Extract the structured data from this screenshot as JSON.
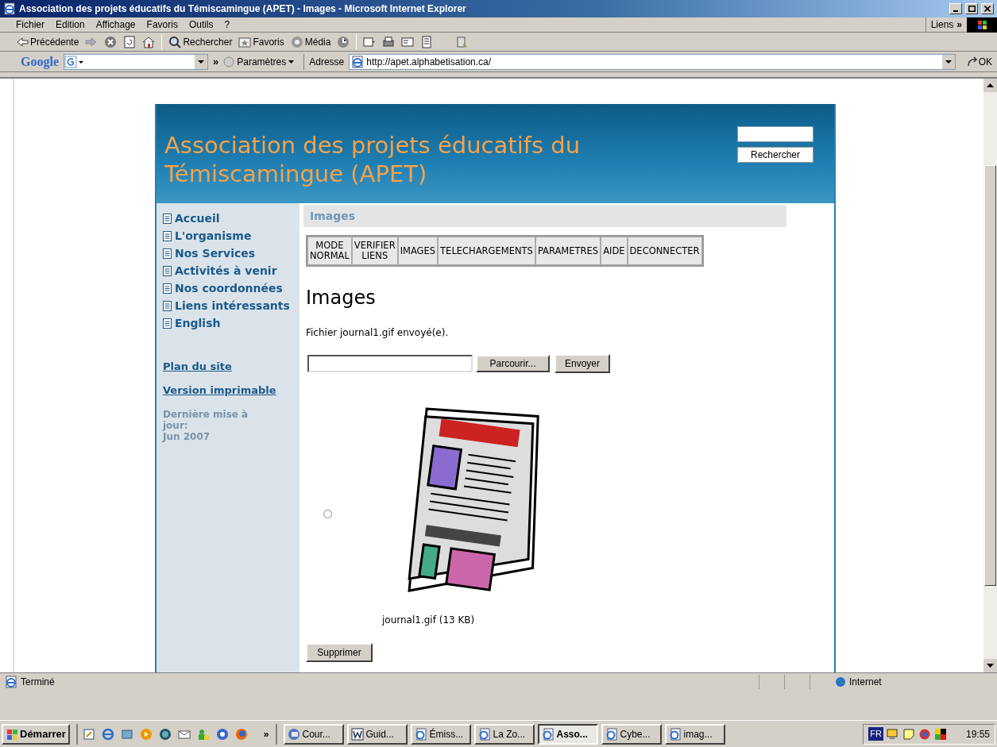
{
  "window": {
    "title": "Association des projets éducatifs du Témiscamingue (APET) - Images - Microsoft Internet Explorer"
  },
  "menu": [
    "Fichier",
    "Edition",
    "Affichage",
    "Favoris",
    "Outils",
    "?"
  ],
  "links_bar": {
    "label": "Liens",
    "more": "»"
  },
  "toolbar": [
    {
      "kind": "back",
      "label": "Précédente"
    },
    {
      "kind": "forward"
    },
    {
      "kind": "stop"
    },
    {
      "kind": "refresh"
    },
    {
      "kind": "home"
    },
    {
      "kind": "search",
      "label": "Rechercher"
    },
    {
      "kind": "favorites",
      "label": "Favoris"
    },
    {
      "kind": "media",
      "label": "Média"
    },
    {
      "kind": "history"
    },
    {
      "kind": "mail"
    },
    {
      "kind": "print"
    },
    {
      "kind": "edit"
    },
    {
      "kind": "discuss"
    },
    {
      "kind": "research"
    }
  ],
  "google_bar": {
    "logo": "Google",
    "more": "»",
    "settings": "Paramètres"
  },
  "address": {
    "label": "Adresse",
    "value": "http://apet.alphabetisation.ca/",
    "go": "OK"
  },
  "site": {
    "title": "Association des projets éducatifs du Témiscamingue (APET)",
    "search_button": "Rechercher",
    "nav": [
      {
        "label": "Accueil"
      },
      {
        "label": "L'organisme"
      },
      {
        "label": "Nos Services"
      },
      {
        "label": "Activités à venir"
      },
      {
        "label": "Nos coordonnées"
      },
      {
        "label": "Liens intéressants"
      },
      {
        "label": "English"
      }
    ],
    "links": [
      "Plan du site",
      "Version imprimable"
    ],
    "updated": {
      "label": "Dernière mise à jour:",
      "date": "Jun 2007"
    },
    "breadcrumb": "Images",
    "admin_tabs": [
      {
        "label": "MODE\nNORMAL"
      },
      {
        "label": "VERIFIER\nLIENS"
      },
      {
        "label": "IMAGES"
      },
      {
        "label": "TELECHARGEMENTS"
      },
      {
        "label": "PARAMETRES"
      },
      {
        "label": "AIDE"
      },
      {
        "label": "DECONNECTER"
      }
    ],
    "heading": "Images",
    "message": "Fichier journal1.gif envoyé(e).",
    "upload": {
      "browse": "Parcourir...",
      "send": "Envoyer"
    },
    "images": [
      {
        "caption": "journal1.gif (13 KB)",
        "selected": false
      }
    ],
    "delete": "Supprimer"
  },
  "status_bar": {
    "text": "Terminé",
    "zone": "Internet"
  },
  "taskbar": {
    "start": "Démarrer",
    "more": "»",
    "tasks": [
      {
        "label": "Cour...",
        "kind": "outlook",
        "selected": false
      },
      {
        "label": "Guid...",
        "kind": "word",
        "selected": false
      },
      {
        "label": "Émiss...",
        "kind": "ie",
        "selected": false
      },
      {
        "label": "La Zo...",
        "kind": "ie",
        "selected": false
      },
      {
        "label": "Asso...",
        "kind": "ie",
        "selected": true
      },
      {
        "label": "Cybe...",
        "kind": "ie",
        "selected": false
      },
      {
        "label": "imag...",
        "kind": "ie",
        "selected": false
      }
    ],
    "language": "FR",
    "clock": "19:55"
  }
}
